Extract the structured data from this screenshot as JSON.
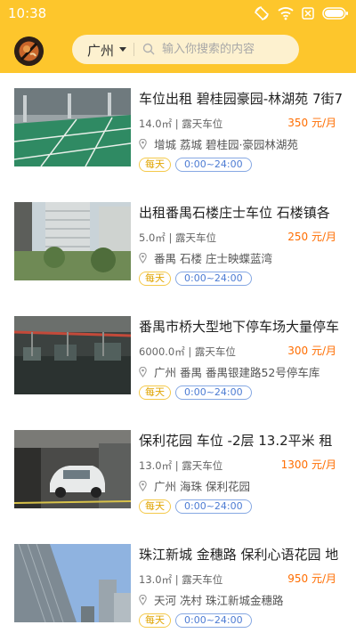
{
  "status_bar": {
    "time": "10:38"
  },
  "header": {
    "city": "广州",
    "search_placeholder": "输入你搜索的内容"
  },
  "listings": [
    {
      "title": "车位出租 碧桂园豪园-林湖苑 7街7",
      "area_type": "14.0㎡ | 露天车位",
      "price": "350 元/月",
      "location": "增城   荔城   碧桂园·豪园林湖苑",
      "tag_day": "每天",
      "tag_time": "0:00~24:00"
    },
    {
      "title": "出租番禺石楼庄士车位 石楼镇各",
      "area_type": "5.0㎡ | 露天车位",
      "price": "250 元/月",
      "location": "番禺   石楼   庄士映蝶蓝湾",
      "tag_day": "每天",
      "tag_time": "0:00~24:00"
    },
    {
      "title": "番禺市桥大型地下停车场大量停车",
      "area_type": "6000.0㎡ | 露天车位",
      "price": "300 元/月",
      "location": "广州  番禺   番禺银建路52号停车库",
      "tag_day": "每天",
      "tag_time": "0:00~24:00"
    },
    {
      "title": "保利花园 车位 -2层 13.2平米 租",
      "area_type": "13.0㎡ | 露天车位",
      "price": "1300 元/月",
      "location": "广州  海珠   保利花园",
      "tag_day": "每天",
      "tag_time": "0:00~24:00"
    },
    {
      "title": "珠江新城 金穗路 保利心语花园 地",
      "area_type": "13.0㎡ | 露天车位",
      "price": "950 元/月",
      "location": "天河   冼村   珠江新城金穗路",
      "tag_day": "每天",
      "tag_time": "0:00~24:00"
    }
  ]
}
